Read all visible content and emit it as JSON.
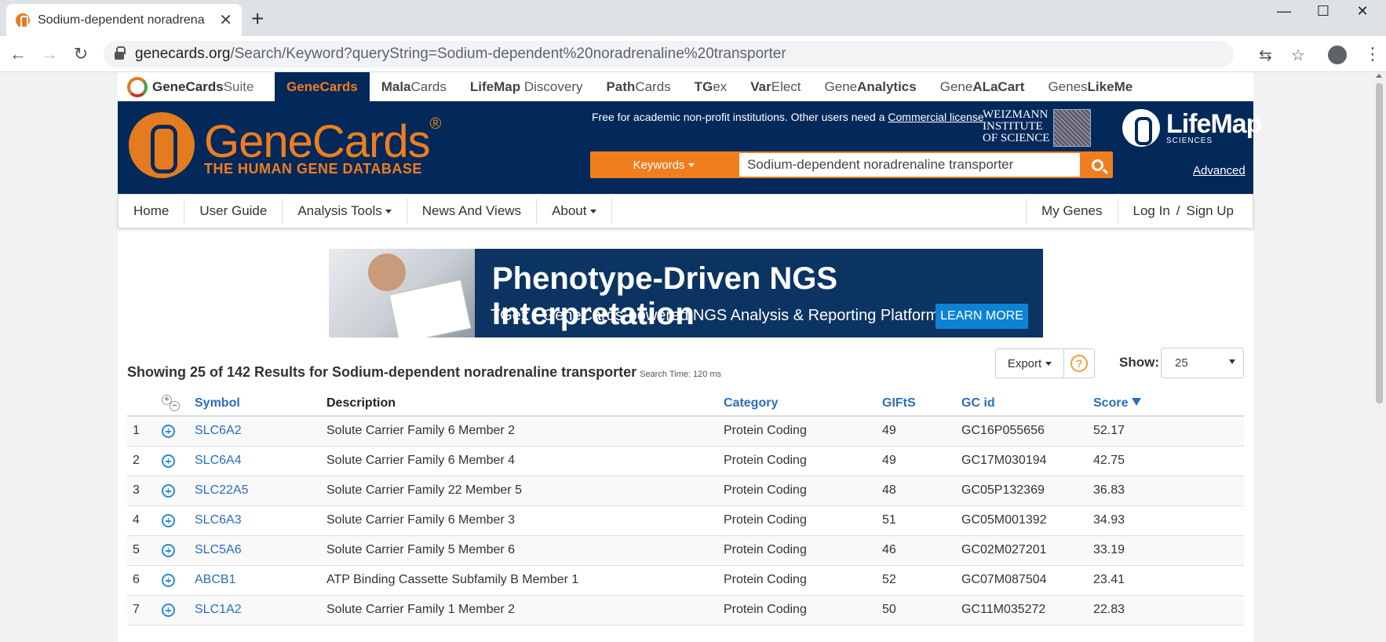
{
  "browser": {
    "tab_title": "Sodium-dependent noradrena",
    "url_domain": "genecards.org",
    "url_path": "/Search/Keyword?queryString=Sodium-dependent%20noradrenaline%20transporter"
  },
  "suite": {
    "logo_bold": "GeneCards",
    "logo_rest": "Suite",
    "items": [
      {
        "bold": "Gene",
        "rest": "Cards"
      },
      {
        "bold": "Mala",
        "rest": "Cards"
      },
      {
        "bold": "LifeMap",
        "rest": " Discovery"
      },
      {
        "bold": "Path",
        "rest": "Cards"
      },
      {
        "bold": "TG",
        "rest": "ex"
      },
      {
        "bold": "Var",
        "rest": "Elect"
      },
      {
        "bold": "Analytics",
        "pre": "Gene"
      },
      {
        "bold": "ALaCart",
        "pre": "Gene"
      },
      {
        "bold": "Like",
        "pre": "Genes",
        "post": "Me"
      }
    ]
  },
  "banner": {
    "brand": "GeneCards",
    "reg": "®",
    "tagline": "THE HUMAN GENE DATABASE",
    "free_note": "Free for academic non-profit institutions. Other users need a",
    "license_link": "Commercial license",
    "weizmann": [
      "WEIZMANN",
      "INSTITUTE",
      "OF SCIENCE"
    ],
    "lifemap_name": "LifeMap",
    "lifemap_sub": "SCIENCES",
    "search_type": "Keywords",
    "search_value": "Sodium-dependent noradrenaline transporter",
    "advanced": "Advanced"
  },
  "nav": {
    "home": "Home",
    "user_guide": "User Guide",
    "analysis_tools": "Analysis Tools",
    "news": "News And Views",
    "about": "About",
    "my_genes": "My Genes",
    "login": "Log In",
    "slash": "/",
    "signup": "Sign Up"
  },
  "ad": {
    "title": "Phenotype-Driven NGS Interpretation",
    "subtitle": "TGex - GeneCards-powered NGS Analysis & Reporting Platform",
    "cta": "LEARN MORE"
  },
  "results": {
    "heading": "Showing 25 of 142 Results for Sodium-dependent noradrenaline transporter",
    "search_time": "Search Time: 120 ms",
    "export": "Export",
    "help": "?",
    "show_label": "Show:",
    "show_value": "25",
    "columns": {
      "symbol": "Symbol",
      "description": "Description",
      "category": "Category",
      "gifts": "GIFtS",
      "gcid": "GC id",
      "score": "Score"
    },
    "rows": [
      {
        "n": "1",
        "symbol": "SLC6A2",
        "description": "Solute Carrier Family 6 Member 2",
        "category": "Protein Coding",
        "gifts": "49",
        "gcid": "GC16P055656",
        "score": "52.17"
      },
      {
        "n": "2",
        "symbol": "SLC6A4",
        "description": "Solute Carrier Family 6 Member 4",
        "category": "Protein Coding",
        "gifts": "49",
        "gcid": "GC17M030194",
        "score": "42.75"
      },
      {
        "n": "3",
        "symbol": "SLC22A5",
        "description": "Solute Carrier Family 22 Member 5",
        "category": "Protein Coding",
        "gifts": "48",
        "gcid": "GC05P132369",
        "score": "36.83"
      },
      {
        "n": "4",
        "symbol": "SLC6A3",
        "description": "Solute Carrier Family 6 Member 3",
        "category": "Protein Coding",
        "gifts": "51",
        "gcid": "GC05M001392",
        "score": "34.93"
      },
      {
        "n": "5",
        "symbol": "SLC5A6",
        "description": "Solute Carrier Family 5 Member 6",
        "category": "Protein Coding",
        "gifts": "46",
        "gcid": "GC02M027201",
        "score": "33.19"
      },
      {
        "n": "6",
        "symbol": "ABCB1",
        "description": "ATP Binding Cassette Subfamily B Member 1",
        "category": "Protein Coding",
        "gifts": "52",
        "gcid": "GC07M087504",
        "score": "23.41"
      },
      {
        "n": "7",
        "symbol": "SLC1A2",
        "description": "Solute Carrier Family 1 Member 2",
        "category": "Protein Coding",
        "gifts": "50",
        "gcid": "GC11M035272",
        "score": "22.83"
      }
    ]
  },
  "colors": {
    "brand_orange": "#f07d1e",
    "brand_navy": "#03295a",
    "link_blue": "#2a6ebb"
  }
}
